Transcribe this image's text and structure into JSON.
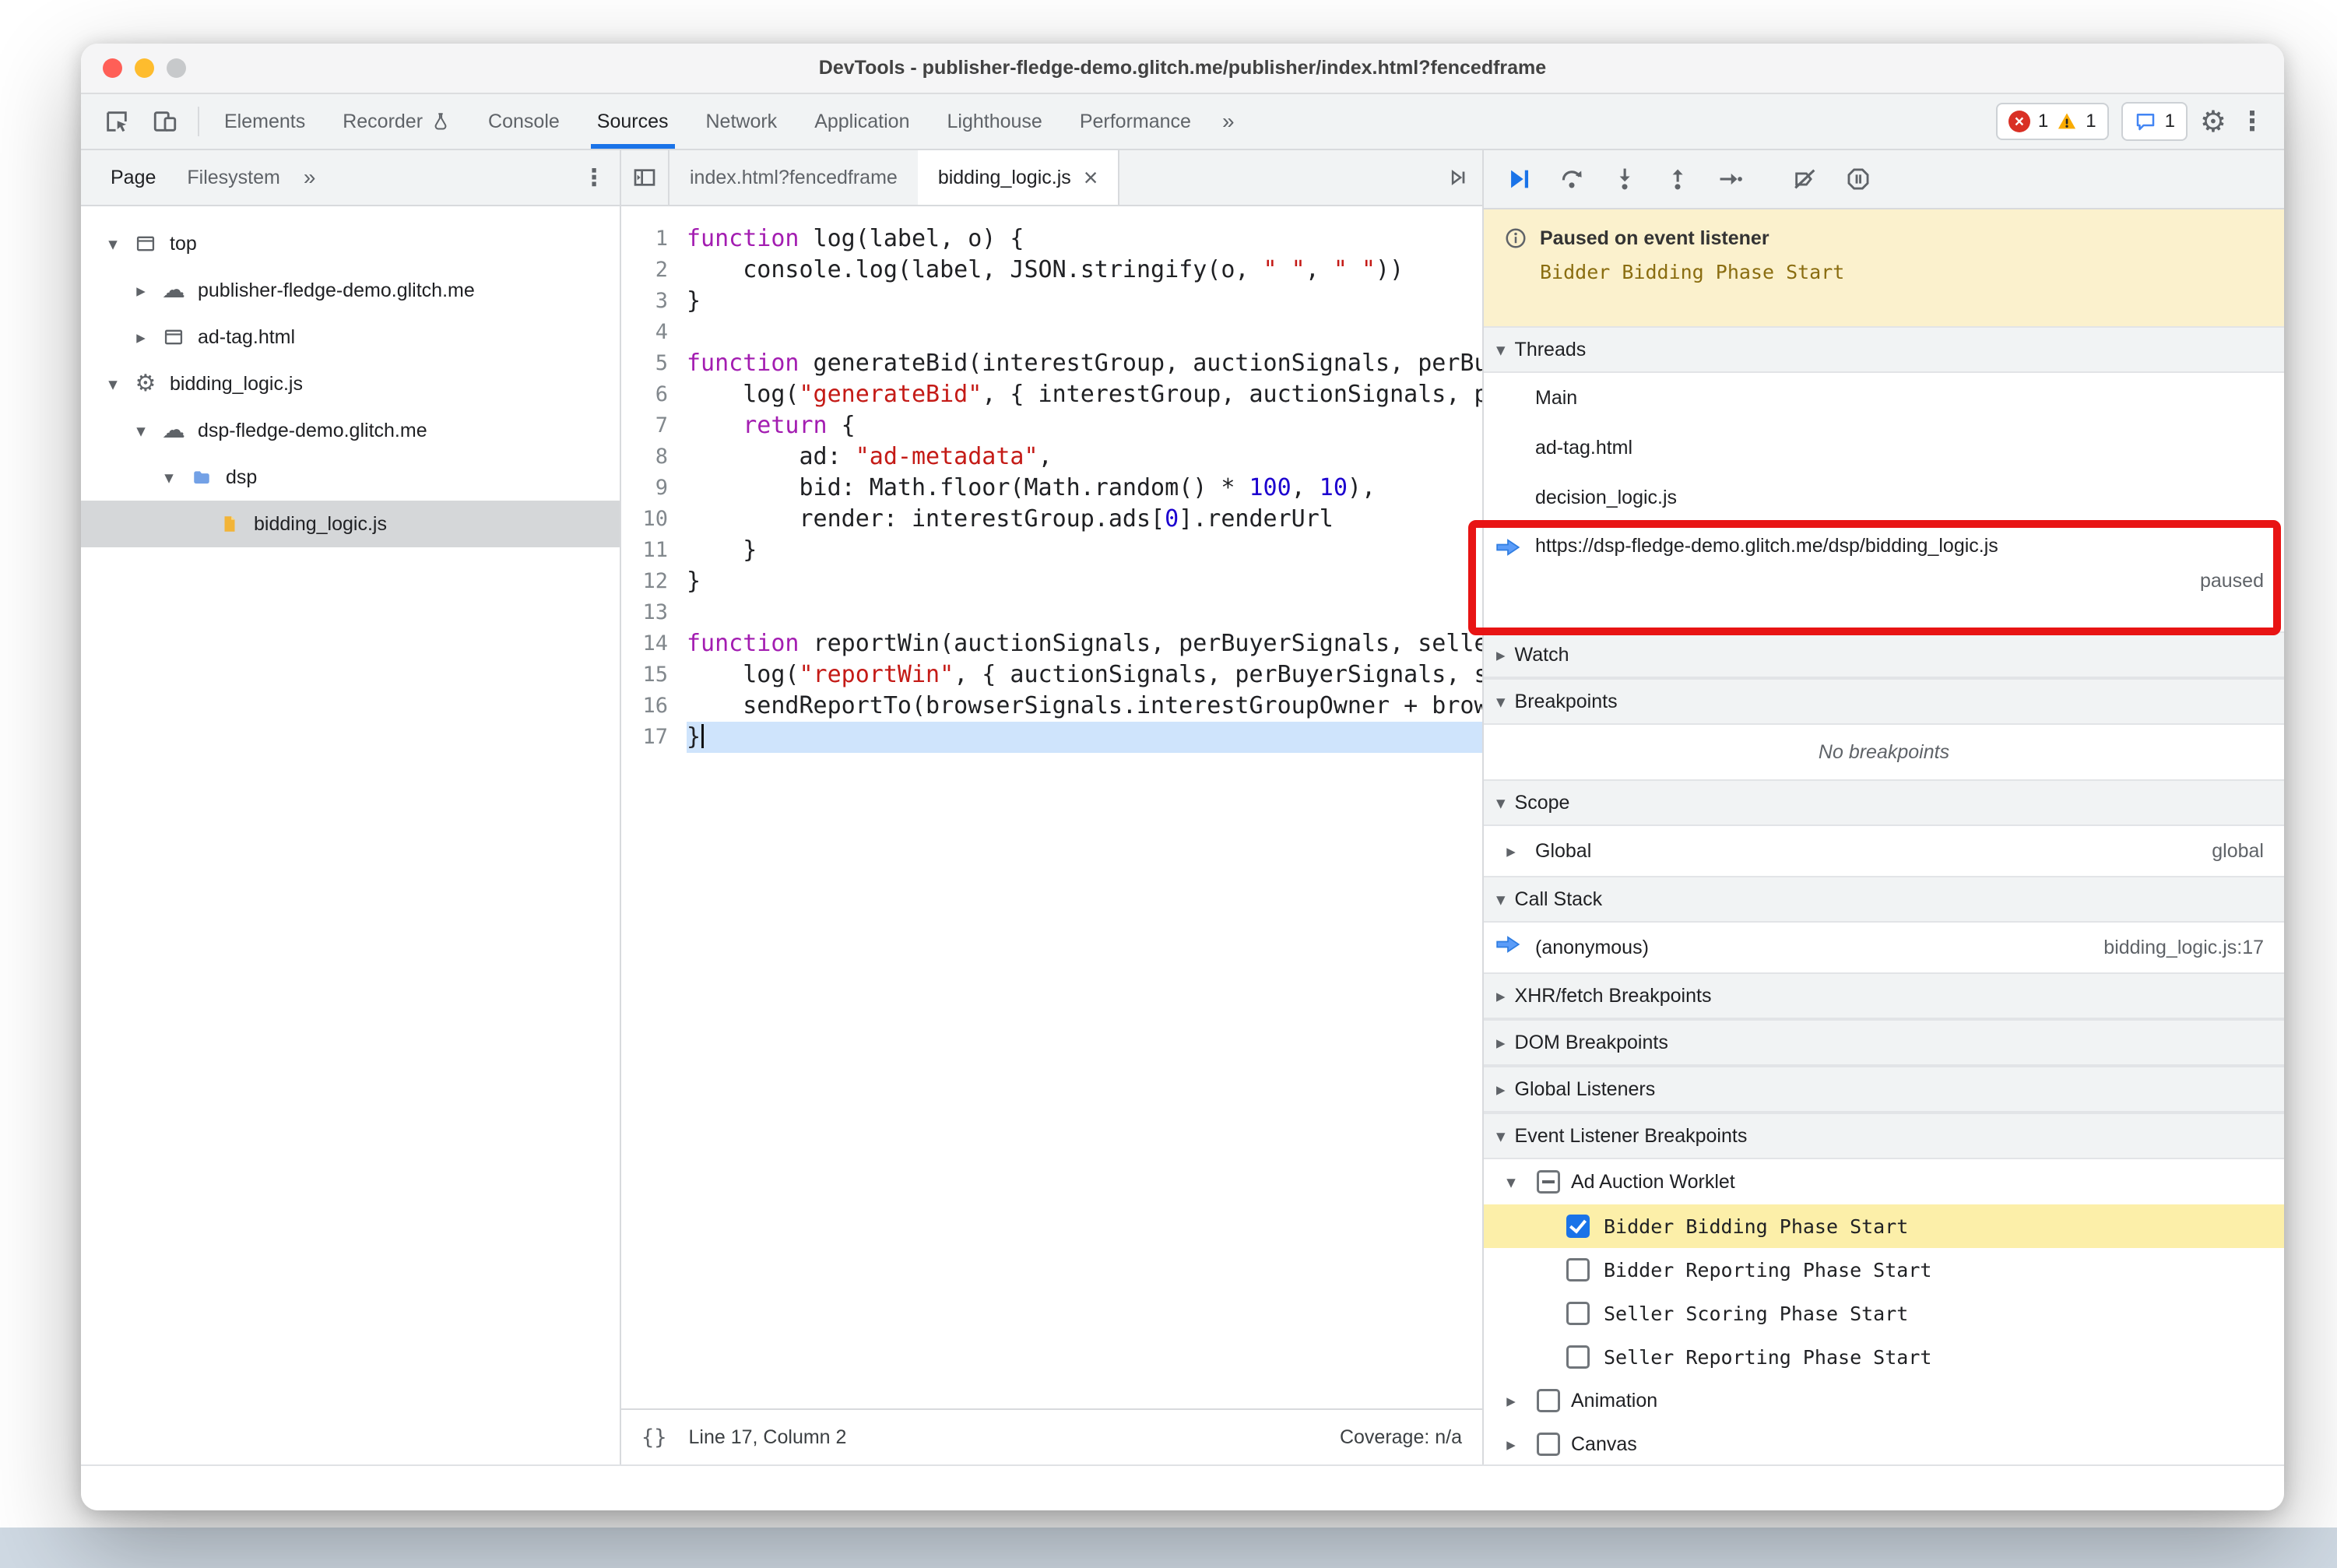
{
  "window": {
    "title": "DevTools - publisher-fledge-demo.glitch.me/publisher/index.html?fencedframe"
  },
  "colors": {
    "accent": "#1a73e8",
    "error": "#d93025",
    "warning": "#f9ab00",
    "paused_banner_bg": "#fbf1cd",
    "highlight_row_bg": "#fcefa9",
    "annotation_red": "#e81414",
    "keyword": "#a31db1",
    "string": "#c41a16",
    "number": "#1c00cf"
  },
  "icons": {
    "expanded": "▾",
    "collapsed": "▸",
    "close": "×",
    "kebab": "⋮",
    "gear": "⚙",
    "cloud": "☁",
    "overflow": "»",
    "error_x": "×"
  },
  "toolbar": {
    "tabs": [
      "Elements",
      "Recorder",
      "Console",
      "Sources",
      "Network",
      "Application",
      "Lighthouse",
      "Performance"
    ],
    "active_tab": "Sources",
    "error_count": "1",
    "warning_count": "1",
    "message_count": "1"
  },
  "navigator": {
    "tabs": [
      "Page",
      "Filesystem"
    ],
    "tree": [
      {
        "label": "top"
      },
      {
        "label": "publisher-fledge-demo.glitch.me"
      },
      {
        "label": "ad-tag.html"
      },
      {
        "label": "bidding_logic.js"
      },
      {
        "label": "dsp-fledge-demo.glitch.me"
      },
      {
        "label": "dsp"
      },
      {
        "label": "bidding_logic.js"
      }
    ]
  },
  "editor": {
    "tabs": [
      {
        "label": "index.html?fencedframe"
      },
      {
        "label": "bidding_logic.js"
      }
    ],
    "status": {
      "brackets": "{}",
      "position": "Line 17, Column 2",
      "coverage": "Coverage: n/a"
    },
    "lines": [
      {
        "num": 1,
        "segs": [
          {
            "c": "kw",
            "t": "function"
          },
          {
            "t": " log(label, o) {"
          }
        ]
      },
      {
        "num": 2,
        "segs": [
          {
            "t": "    console.log(label, JSON.stringify(o, "
          },
          {
            "c": "str",
            "t": "\" \""
          },
          {
            "t": ", "
          },
          {
            "c": "str",
            "t": "\" \""
          },
          {
            "t": "))"
          }
        ]
      },
      {
        "num": 3,
        "segs": [
          {
            "t": "}"
          }
        ]
      },
      {
        "num": 4,
        "segs": []
      },
      {
        "num": 5,
        "segs": [
          {
            "c": "kw",
            "t": "function"
          },
          {
            "t": " generateBid(interestGroup, auctionSignals, perBuyerSignals, trustedBiddingSignals, browserSignals) {"
          }
        ]
      },
      {
        "num": 6,
        "segs": [
          {
            "t": "    log("
          },
          {
            "c": "str",
            "t": "\"generateBid\""
          },
          {
            "t": ", { interestGroup, auctionSignals, perBuyerSignals, trustedBiddingSignals, browserSignals });"
          }
        ]
      },
      {
        "num": 7,
        "segs": [
          {
            "t": "    "
          },
          {
            "c": "kw",
            "t": "return"
          },
          {
            "t": " {"
          }
        ]
      },
      {
        "num": 8,
        "segs": [
          {
            "t": "        ad: "
          },
          {
            "c": "str",
            "t": "\"ad-metadata\""
          },
          {
            "t": ","
          }
        ]
      },
      {
        "num": 9,
        "segs": [
          {
            "t": "        bid: Math.floor(Math.random() * "
          },
          {
            "c": "num",
            "t": "100"
          },
          {
            "t": ", "
          },
          {
            "c": "num",
            "t": "10"
          },
          {
            "t": "),"
          }
        ]
      },
      {
        "num": 10,
        "segs": [
          {
            "t": "        render: interestGroup.ads["
          },
          {
            "c": "num",
            "t": "0"
          },
          {
            "t": "].renderUrl"
          }
        ]
      },
      {
        "num": 11,
        "segs": [
          {
            "t": "    }"
          }
        ]
      },
      {
        "num": 12,
        "segs": [
          {
            "t": "}"
          }
        ]
      },
      {
        "num": 13,
        "segs": []
      },
      {
        "num": 14,
        "segs": [
          {
            "c": "kw",
            "t": "function"
          },
          {
            "t": " reportWin(auctionSignals, perBuyerSignals, sellerSignals, browserSignals) {"
          }
        ]
      },
      {
        "num": 15,
        "segs": [
          {
            "t": "    log("
          },
          {
            "c": "str",
            "t": "\"reportWin\""
          },
          {
            "t": ", { auctionSignals, perBuyerSignals, sellerSignals, browserSignals });"
          }
        ]
      },
      {
        "num": 16,
        "segs": [
          {
            "t": "    sendReportTo(browserSignals.interestGroupOwner + browserSignals.renderUrl);"
          }
        ]
      },
      {
        "num": 17,
        "segs": [
          {
            "t": "}"
          }
        ],
        "current": true
      }
    ]
  },
  "debugger": {
    "paused": {
      "title": "Paused on event listener",
      "detail": "Bidder Bidding Phase Start"
    },
    "threads": {
      "title": "Threads",
      "items": [
        "Main",
        "ad-tag.html",
        "decision_logic.js"
      ],
      "paused_thread": {
        "url": "https://dsp-fledge-demo.glitch.me/dsp/bidding_logic.js",
        "status": "paused"
      }
    },
    "watch": {
      "title": "Watch"
    },
    "breakpoints": {
      "title": "Breakpoints",
      "empty_message": "No breakpoints"
    },
    "scope": {
      "title": "Scope",
      "rows": [
        {
          "name": "Global",
          "value": "global"
        }
      ]
    },
    "call_stack": {
      "title": "Call Stack",
      "frames": [
        {
          "name": "(anonymous)",
          "location": "bidding_logic.js:17"
        }
      ]
    },
    "xhr": {
      "title": "XHR/fetch Breakpoints"
    },
    "dom": {
      "title": "DOM Breakpoints"
    },
    "global_listeners": {
      "title": "Global Listeners"
    },
    "elb": {
      "title": "Event Listener Breakpoints",
      "group": "Ad Auction Worklet",
      "items": [
        "Bidder Bidding Phase Start",
        "Bidder Reporting Phase Start",
        "Seller Scoring Phase Start",
        "Seller Reporting Phase Start"
      ],
      "more_groups": [
        "Animation",
        "Canvas"
      ]
    }
  }
}
